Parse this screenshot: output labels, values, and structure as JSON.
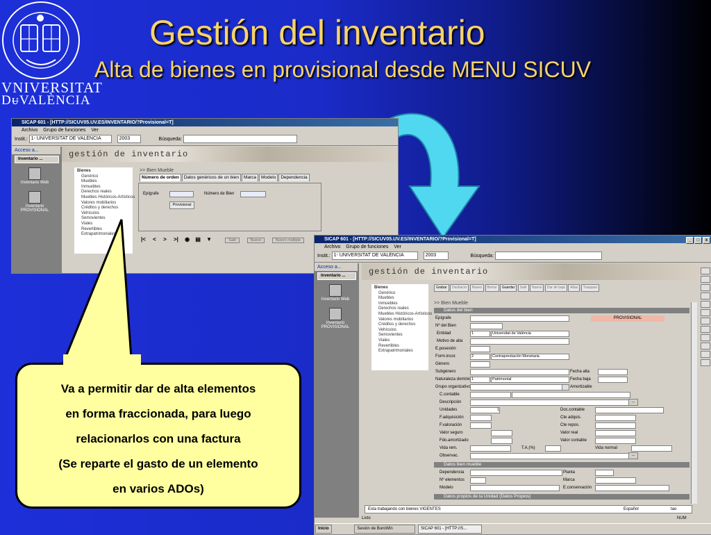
{
  "slide": {
    "title": "Gestión del inventario",
    "subtitle": "Alta de bienes en provisional desde MENU SICUV"
  },
  "logo": {
    "line1": "VNIVERSITAT",
    "line2": "DᵾVALÈNCIA"
  },
  "window1": {
    "title": "SICAP 601 - [HTTP://SICUV05.UV.ES/INVENTARIO/?Provisional=T]",
    "menu": [
      "Archivo",
      "Grupo de funciones",
      "Ver"
    ],
    "instit_label": "Instit.:",
    "instit_value": "1- UNIVERSITAT DE VALÈNCIA",
    "year": "2003",
    "search_label": "Búsqueda:",
    "acceso": "Acceso a...",
    "acc_tab": "Inventario ...",
    "acc_items": [
      "Inventario Web",
      "Inventario PROVISIONAL"
    ],
    "banner": "gestión de inventario",
    "tree_header": "Bienes",
    "tree_items": [
      "Genérico",
      "Muebles",
      "Inmuebles",
      "Derechos reales",
      "Muebles Históricos-Artísticos",
      "Valores mobiliarios",
      "Créditos y derechos",
      "Vehículos",
      "Semovientes",
      "Viales",
      "Revertibles",
      "Extrapatrimoniales"
    ],
    "form_title": "Bien Mueble",
    "tabs": [
      "Número de orden",
      "Datos genéricos de un bien",
      "Marca",
      "Modelo",
      "Dependencia"
    ],
    "epigrafe": "Epígrafe",
    "numero_bien": "Número de Bien",
    "btn_provisional": "Provisional",
    "nav": [
      "|<",
      "<",
      ">",
      ">|"
    ],
    "bottom_btns": [
      "Salir",
      "Nuevo",
      "Nuevo múltiple"
    ]
  },
  "window2": {
    "title": "SICAP 601 - [HTTP://SICUV05.UV.ES/INVENTARIO/?Provisional=T]",
    "menu": [
      "Archivo",
      "Grupo de funciones",
      "Ver"
    ],
    "instit_label": "Instit.:",
    "instit_value": "1- UNIVERSITAT DE VALÈNCIA",
    "year": "2003",
    "search_label": "Búsqueda:",
    "acceso": "Acceso a...",
    "acc_tab": "Inventario ...",
    "acc_items": [
      "Inventario Web",
      "Inventario PROVISIONAL"
    ],
    "banner": "gestión de inventario",
    "tree_header": "Bienes",
    "tree_items": [
      "Genérico",
      "Muebles",
      "Inmuebles",
      "Derechos reales",
      "Muebles Históricos-Artísticos",
      "Valores mobiliarios",
      "Créditos y derechos",
      "Vehículos",
      "Semovientes",
      "Viales",
      "Revertibles",
      "Extrapatrimoniales"
    ],
    "top_buttons": [
      "Grabar",
      "Deshacer",
      "Nuevo",
      "Borrar",
      "Guardar",
      "Salir",
      "Nuevo",
      "Dar de baja",
      "Altas",
      "Traspaso"
    ],
    "form_title": "Bien Mueble",
    "section_datos": "Datos del bien",
    "provisional": "PROVISIONAL",
    "fields": {
      "epigrafe": "Epígrafe",
      "n_bien": "Nº del Bien",
      "entidad": "Entidad",
      "entidad_num": "1",
      "entidad_val": "Universitat de València",
      "motivo": "Motivo de alta",
      "e_posesion": "E.posesión",
      "forma_incor": "Form.incor.",
      "forma_num": "2",
      "forma_val": "Contraprestación Monetaria",
      "genero": "Género",
      "subgenero": "Subgénero",
      "fecha_alta": "Fecha alta",
      "naturaleza": "Naturaleza dominio",
      "nat_num": "1",
      "nat_val": "Patrimonial",
      "fecha_baja": "Fecha baja",
      "grupo_org": "Grupo organizativo",
      "amortizable": "Amortizable",
      "c_contable": "C.contable",
      "descripcion": "Descripción",
      "unidades": "Unidades",
      "unidades_val": "1",
      "doc_contable": "Doc.contable",
      "f_adquisicion": "F.adquisición",
      "cte_adquis": "Cte adquis.",
      "f_valoracion": "F.valoración",
      "cte_repos": "Cte repos.",
      "valor_seguro": "Valor seguro",
      "valor_real": "Valor real",
      "fdo_amortizado": "Fdo.amortizado",
      "valor_contable": "Valor contable",
      "vida_rem": "Vida rem.",
      "ta": "T.A.(%)",
      "vida_normal": "Vida normal",
      "observac": "Observac."
    },
    "section_mueble": "Datos bien mueble",
    "mueble": {
      "dependencia": "Dependencia",
      "planta": "Planta",
      "n_elementos": "Nº elementos",
      "marca": "Marca",
      "modelo": "Modelo",
      "e_conservacion": "E.conservación"
    },
    "section_unidad": "Datos propios de la Unidad (Datos Propios)",
    "status_msg": "Esta trabajando con bienes VIGENTES",
    "lang": "Español",
    "user": "tao",
    "listo": "Listo",
    "num": "NUM",
    "taskbar": [
      "Inicio",
      "Sesión de BuroWin",
      "SICAP 601 - [HTTP://S..."
    ]
  },
  "callout": {
    "lines": [
      "Va a permitir dar de alta elementos",
      "en forma fraccionada, para luego",
      "relacionarlos con una factura",
      "(Se reparte el gasto de un elemento",
      "en varios ADOs)"
    ]
  },
  "colors": {
    "background": "#1d2fd8",
    "title": "#f6d36b",
    "callout_fill": "#ffffa0",
    "arrow_fill": "#4fd8f0",
    "window_face": "#d4d0c8",
    "titlebar": "#0a246a"
  }
}
